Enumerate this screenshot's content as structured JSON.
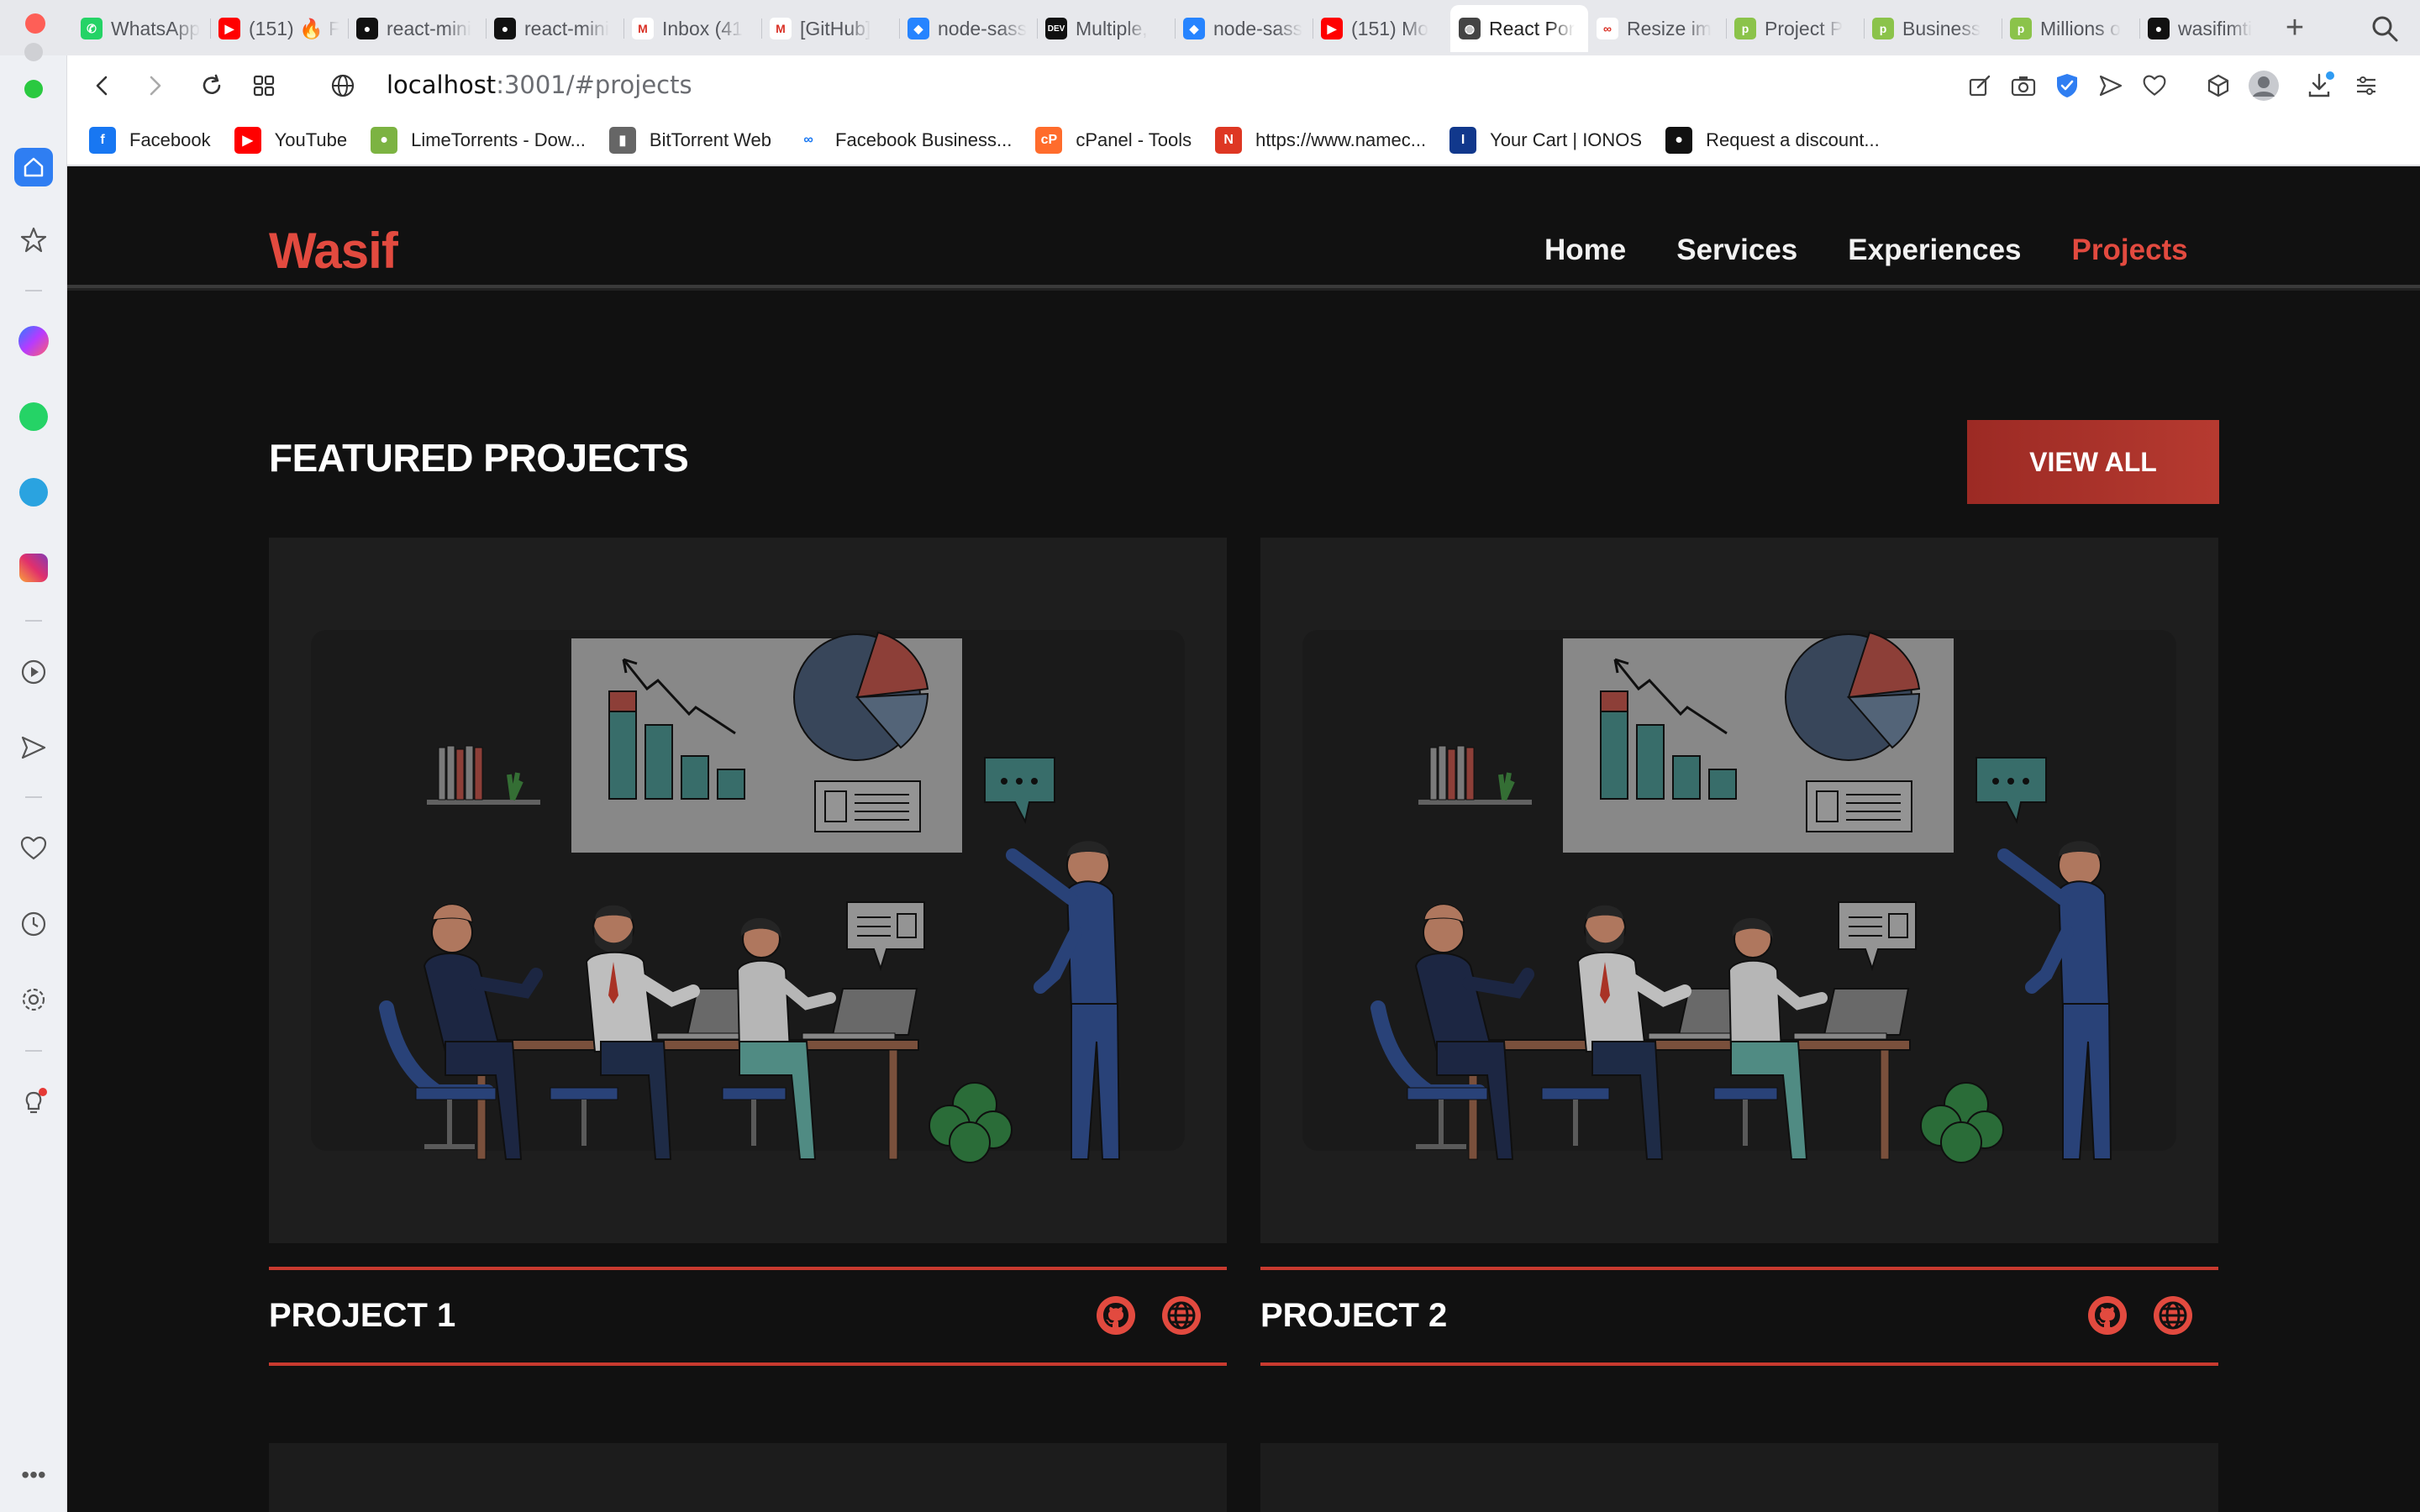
{
  "browser": {
    "tabs": [
      {
        "label": "WhatsApp",
        "icon": "whatsapp-icon",
        "color": "#25d366",
        "glyph": "✆"
      },
      {
        "label": "(151) 🔥 F",
        "icon": "youtube-icon",
        "color": "#ff0000",
        "glyph": "▶"
      },
      {
        "label": "react-mini",
        "icon": "github-icon",
        "color": "#111111",
        "glyph": "●"
      },
      {
        "label": "react-mini",
        "icon": "github-icon",
        "color": "#111111",
        "glyph": "●"
      },
      {
        "label": "Inbox (41",
        "icon": "gmail-icon",
        "color": "#ffffff",
        "glyph": "M"
      },
      {
        "label": "[GitHub]",
        "icon": "gmail-icon",
        "color": "#ffffff",
        "glyph": "M"
      },
      {
        "label": "node-sass",
        "icon": "bitbucket-icon",
        "color": "#2684ff",
        "glyph": "◆"
      },
      {
        "label": "Multiple,",
        "icon": "dev-icon",
        "color": "#111111",
        "glyph": "DEV"
      },
      {
        "label": "node-sass",
        "icon": "bitbucket-icon",
        "color": "#2684ff",
        "glyph": "◆"
      },
      {
        "label": "(151) Mo",
        "icon": "youtube-icon",
        "color": "#ff0000",
        "glyph": "▶"
      },
      {
        "label": "React Por",
        "icon": "globe-icon",
        "color": "#444444",
        "glyph": "◍",
        "active": true
      },
      {
        "label": "Resize im",
        "icon": "resize-icon",
        "color": "#ffffff",
        "glyph": "∞"
      },
      {
        "label": "Project P",
        "icon": "p-icon",
        "color": "#8bc34a",
        "glyph": "p"
      },
      {
        "label": "Business",
        "icon": "p-icon",
        "color": "#8bc34a",
        "glyph": "p"
      },
      {
        "label": "Millions o",
        "icon": "p-icon",
        "color": "#8bc34a",
        "glyph": "p"
      },
      {
        "label": "wasifimti",
        "icon": "github-icon",
        "color": "#111111",
        "glyph": "●"
      }
    ],
    "url_host": "localhost",
    "url_path": ":3001/#projects",
    "bookmarks": [
      {
        "label": "Facebook",
        "icon": "facebook-icon",
        "color": "#1877f2",
        "glyph": "f"
      },
      {
        "label": "YouTube",
        "icon": "youtube-icon",
        "color": "#ff0000",
        "glyph": "▶"
      },
      {
        "label": "LimeTorrents - Dow...",
        "icon": "lime-icon",
        "color": "#7cb342",
        "glyph": "●"
      },
      {
        "label": "BitTorrent Web",
        "icon": "file-icon",
        "color": "#666666",
        "glyph": "▮"
      },
      {
        "label": "Facebook Business...",
        "icon": "meta-icon",
        "color": "#ffffff",
        "glyph": "∞"
      },
      {
        "label": "cPanel - Tools",
        "icon": "cpanel-icon",
        "color": "#ff6c2c",
        "glyph": "cP"
      },
      {
        "label": "https://www.namec...",
        "icon": "namecheap-icon",
        "color": "#de3723",
        "glyph": "N"
      },
      {
        "label": "Your Cart | IONOS",
        "icon": "ionos-icon",
        "color": "#11388c",
        "glyph": "I"
      },
      {
        "label": "Request a discount...",
        "icon": "github-icon",
        "color": "#111111",
        "glyph": "●"
      }
    ]
  },
  "site": {
    "brand": "Wasif",
    "nav": [
      {
        "label": "Home",
        "active": false
      },
      {
        "label": "Services",
        "active": false
      },
      {
        "label": "Experiences",
        "active": false
      },
      {
        "label": "Projects",
        "active": true
      }
    ],
    "section_title": "FEATURED PROJECTS",
    "view_all": "VIEW ALL",
    "projects": [
      {
        "title": "PROJECT 1",
        "image_icon": "team-meeting-illustration",
        "links": [
          "github-icon",
          "globe-icon"
        ]
      },
      {
        "title": "PROJECT 2",
        "image_icon": "team-meeting-illustration",
        "links": [
          "github-icon",
          "globe-icon"
        ]
      }
    ],
    "accent": "#e24a3f"
  }
}
